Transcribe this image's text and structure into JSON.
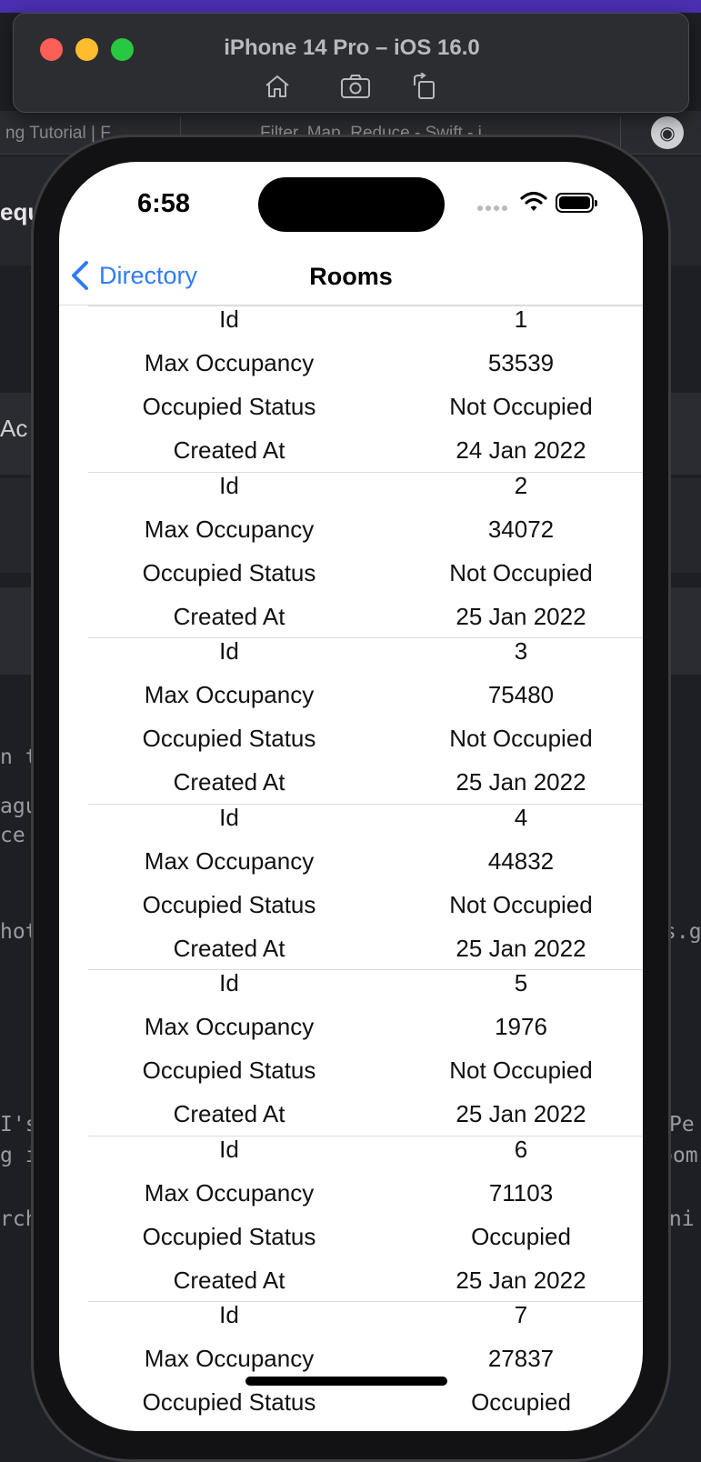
{
  "simulator": {
    "title": "iPhone 14 Pro – iOS 16.0",
    "tools": [
      "home-icon",
      "screenshot-icon",
      "rotate-icon"
    ]
  },
  "background": {
    "tabs": [
      "ng Tutorial | F",
      "Filter, Map, Reduce - Swift - i"
    ],
    "fragments": [
      "equ",
      "Ac",
      "n t",
      "agu",
      "ce",
      "hot",
      "s.g",
      "I's",
      "g i",
      "Pe",
      "pom",
      "rch",
      "Uni"
    ]
  },
  "status_bar": {
    "time": "6:58"
  },
  "nav": {
    "back_label": "Directory",
    "title": "Rooms"
  },
  "labels": {
    "id": "Id",
    "max_occupancy": "Max Occupancy",
    "occupied_status": "Occupied Status",
    "created_at": "Created At"
  },
  "rooms": [
    {
      "id": "1",
      "max_occupancy": "53539",
      "occupied_status": "Not Occupied",
      "created_at": "24 Jan 2022"
    },
    {
      "id": "2",
      "max_occupancy": "34072",
      "occupied_status": "Not Occupied",
      "created_at": "25 Jan 2022"
    },
    {
      "id": "3",
      "max_occupancy": "75480",
      "occupied_status": "Not Occupied",
      "created_at": "25 Jan 2022"
    },
    {
      "id": "4",
      "max_occupancy": "44832",
      "occupied_status": "Not Occupied",
      "created_at": "25 Jan 2022"
    },
    {
      "id": "5",
      "max_occupancy": "1976",
      "occupied_status": "Not Occupied",
      "created_at": "25 Jan 2022"
    },
    {
      "id": "6",
      "max_occupancy": "71103",
      "occupied_status": "Occupied",
      "created_at": "25 Jan 2022"
    },
    {
      "id": "7",
      "max_occupancy": "27837",
      "occupied_status": "Occupied",
      "created_at": ""
    }
  ],
  "colors": {
    "accent": "#2f7cf6",
    "close": "#ff5f57",
    "minimize": "#febc2e",
    "zoom": "#28c840"
  }
}
